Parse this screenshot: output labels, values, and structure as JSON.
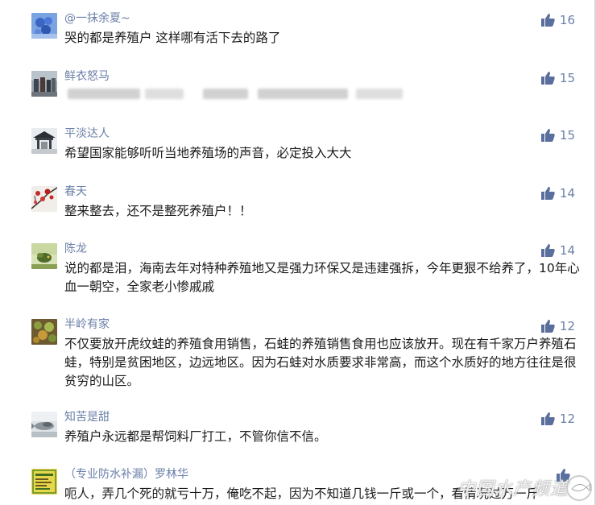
{
  "comments": [
    {
      "name": "@一抹余夏~",
      "text": "哭的都是养殖户 这样哪有活下去的路了",
      "likes": "16"
    },
    {
      "name": "鲜衣怒马",
      "text": "",
      "likes": "15"
    },
    {
      "name": "平淡达人",
      "text": "希望国家能够听听当地养殖场的声音，必定投入大大",
      "likes": "15"
    },
    {
      "name": "春天",
      "text": "整来整去，还不是整死养殖户！！",
      "likes": "14"
    },
    {
      "name": "陈龙",
      "text": "说的都是泪，海南去年对特种养殖地又是强力环保又是违建强拆，今年更狠不给养了，10年心血一朝空，全家老小惨戚戚",
      "likes": "14"
    },
    {
      "name": "半岭有家",
      "text": "不仅要放开虎纹蛙的养殖食用销售，石蛙的养殖销售食用也应该放开。现在有千家万户养殖石蛙，特别是贫困地区，边远地区。因为石蛙对水质要求非常高，而这个水质好的地方往往是很贫穷的山区。",
      "likes": "12"
    },
    {
      "name": "知苦是甜",
      "text": "养殖户永远都是帮饲料厂打工，不管你信不信。",
      "likes": "12"
    },
    {
      "name": "（专业防水补漏）罗林华",
      "text": "呃人，弄几个死的就亏十万，俺吃不起，因为不知道几钱一斤或一个，看情况过万一斤",
      "likes": ""
    }
  ],
  "watermark": {
    "text": "中国水产频道"
  },
  "colors": {
    "name": "#6b7fa8",
    "like_icon": "#5a6f9e",
    "text": "#1a1a1a"
  },
  "icons": {
    "like": "thumbs-up-icon"
  }
}
